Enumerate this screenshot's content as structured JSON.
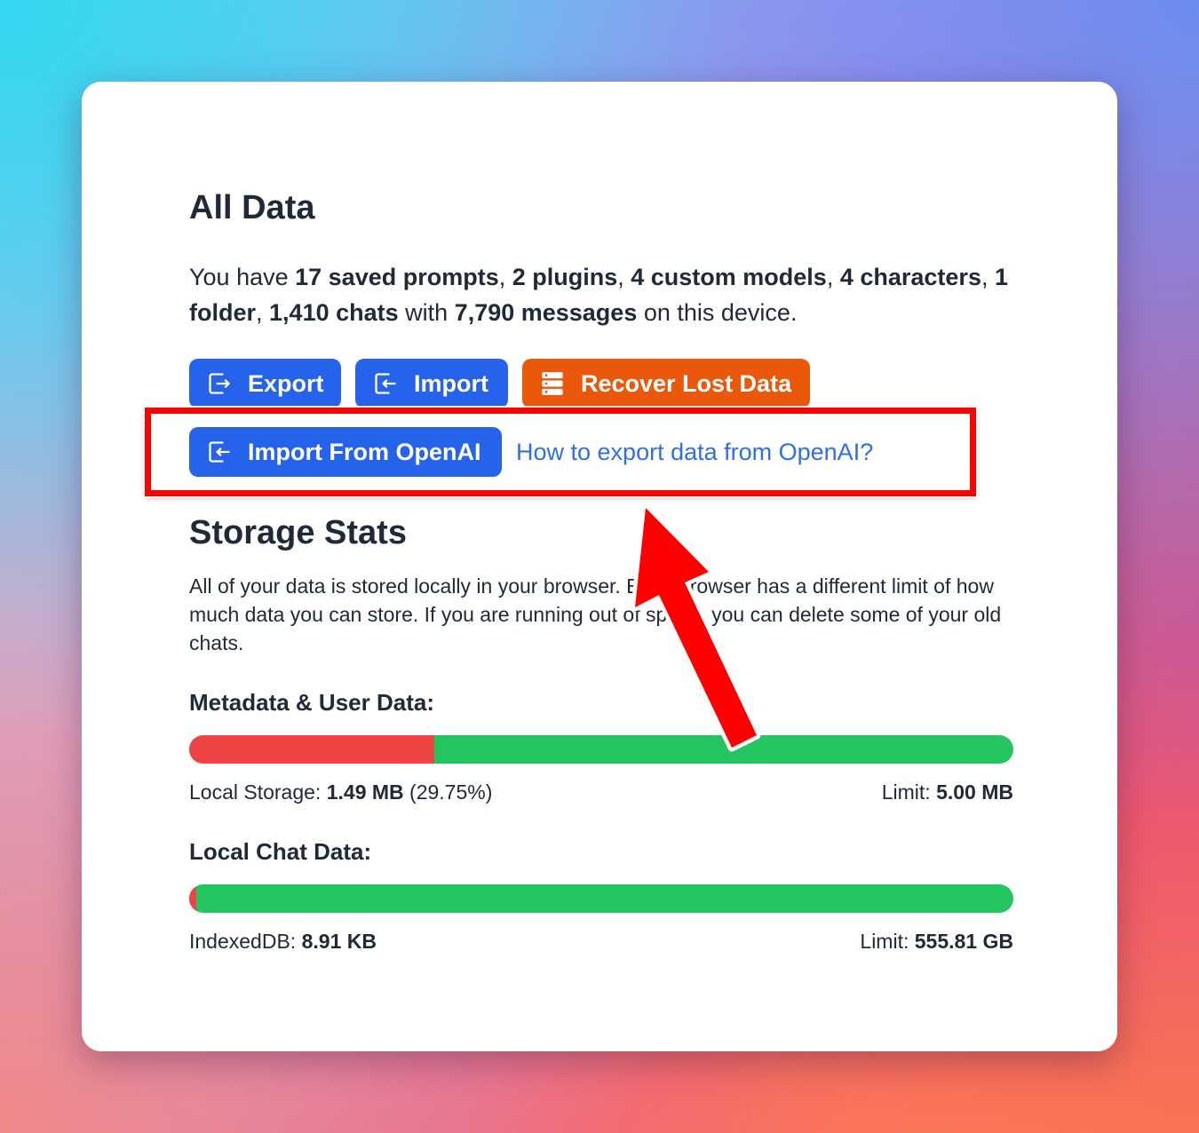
{
  "all_data": {
    "title": "All Data",
    "summary": {
      "p1": "You have ",
      "prompts": "17 saved prompts",
      "s1": ", ",
      "plugins": "2 plugins",
      "s2": ", ",
      "models": "4 custom models",
      "s3": ", ",
      "characters": "4 characters",
      "s4": ", ",
      "folders": "1 folder",
      "s5": ", ",
      "chats": "1,410 chats",
      "s6": " with ",
      "messages": "7,790 messages",
      "s7": " on this device."
    },
    "buttons": {
      "export": "Export",
      "import": "Import",
      "recover": "Recover Lost Data",
      "import_openai": "Import From OpenAI"
    },
    "openai_link": "How to export data from OpenAI?"
  },
  "storage": {
    "title": "Storage Stats",
    "description": "All of your data is stored locally in your browser. Each browser has a different limit of how much data you can store. If you are running out of space, you can delete some of your old chats.",
    "metadata": {
      "label": "Metadata & User Data:",
      "used_label": "Local Storage: ",
      "used_value": "1.49 MB",
      "used_percent": "(29.75%)",
      "used_fraction": 0.2975,
      "limit_label": "Limit: ",
      "limit_value": "5.00 MB"
    },
    "chat": {
      "label": "Local Chat Data:",
      "used_label": "IndexedDB: ",
      "used_value": "8.91 KB",
      "used_fraction": 2e-05,
      "limit_label": "Limit: ",
      "limit_value": "555.81 GB"
    }
  },
  "colors": {
    "primary_button": "#2563eb",
    "warning_button": "#ea580c",
    "link": "#2f6fe0",
    "bar_used": "#ef4444",
    "bar_free": "#22c55e",
    "annotation": "#ff0000"
  },
  "icons": {
    "export": "export-icon",
    "import": "import-icon",
    "recover": "database-icon",
    "import_openai": "import-icon"
  }
}
